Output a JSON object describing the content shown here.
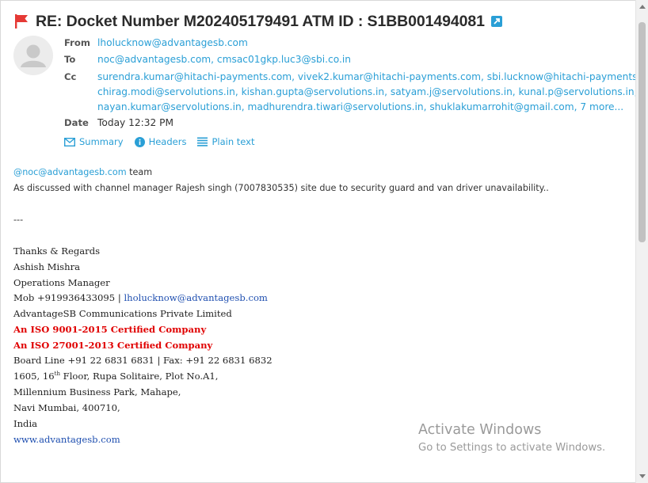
{
  "subject": "RE: Docket Number M202405179491 ATM ID : S1BB001494081",
  "header": {
    "from_label": "From",
    "from_value": "lholucknow@advantagesb.com",
    "to_label": "To",
    "to_value": "noc@advantagesb.com, cmsac01gkp.luc3@sbi.co.in",
    "cc_label": "Cc",
    "cc_lines": [
      "surendra.kumar@hitachi-payments.com, vivek2.kumar@hitachi-payments.com, sbi.lucknow@hitachi-payments.com,",
      "chirag.modi@servolutions.in, kishan.gupta@servolutions.in, satyam.j@servolutions.in, kunal.p@servolutions.in,",
      "nayan.kumar@servolutions.in, madhurendra.tiwari@servolutions.in, shuklakumarrohit@gmail.com,"
    ],
    "cc_more": "7 more...",
    "date_label": "Date",
    "date_value": "Today 12:32 PM"
  },
  "actions": {
    "summary": "Summary",
    "headers": "Headers",
    "plain_text": "Plain text"
  },
  "body": {
    "mention": "@noc@advantagesb.com",
    "mention_suffix": " team",
    "message": "As discussed with channel manager Rajesh singh (7007830535) site due to security guard and van driver unavailability..",
    "separator": "---"
  },
  "signature": {
    "regards": "Thanks & Regards",
    "name": "Ashish Mishra",
    "title": "Operations Manager",
    "mob_prefix": "Mob +919936433095 | ",
    "mob_email": "lholucknow@advantagesb.com",
    "company": "AdvantageSB Communications Private Limited",
    "iso1": "An ISO 9001-2015 Certified Company",
    "iso2": "An ISO 27001-2013 Certified Company",
    "phones": "Board Line +91 22 6831 6831 | Fax: +91 22 6831 6832",
    "addr1_a": "1605, 16",
    "addr1_sup": "th",
    "addr1_b": " Floor, Rupa Solitaire, Plot No.A1,",
    "addr2": "Millennium Business Park, Mahape,",
    "addr3": "Navi Mumbai, 400710,",
    "addr4": "India",
    "website": "www.advantagesb.com"
  },
  "watermark": {
    "title": "Activate Windows",
    "subtitle": "Go to Settings to activate Windows."
  },
  "colors": {
    "link": "#2a9fd6",
    "flag": "#e53935",
    "iso_red": "#e00000",
    "sig_link": "#1f4fb0"
  },
  "icons": {
    "flag": "flag-icon",
    "popout": "external-link-icon",
    "avatar": "user-avatar-icon",
    "summary": "envelope-icon",
    "headers": "info-icon",
    "plain_text": "lines-icon"
  }
}
